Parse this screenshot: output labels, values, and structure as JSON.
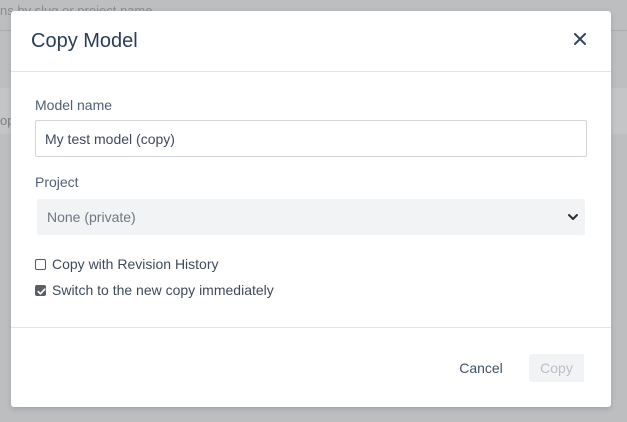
{
  "background": {
    "search_text": "ns by slug or project name",
    "side_text": "op"
  },
  "dialog": {
    "title": "Copy Model",
    "close_icon": "close-icon",
    "model_name_label": "Model name",
    "model_name_value": "My test model (copy)",
    "project_label": "Project",
    "project_selected": "None (private)",
    "project_chevron_icon": "chevron-down-icon",
    "options": [
      {
        "label": "Copy with Revision History",
        "checked": false
      },
      {
        "label": "Switch to the new copy immediately",
        "checked": true
      }
    ],
    "cancel_label": "Cancel",
    "copy_label": "Copy"
  },
  "colors": {
    "title": "#283d5a",
    "overlay": "#bdbec0",
    "copy_disabled_bg": "#f2f3f5",
    "copy_disabled_text": "#b9bfc7"
  }
}
